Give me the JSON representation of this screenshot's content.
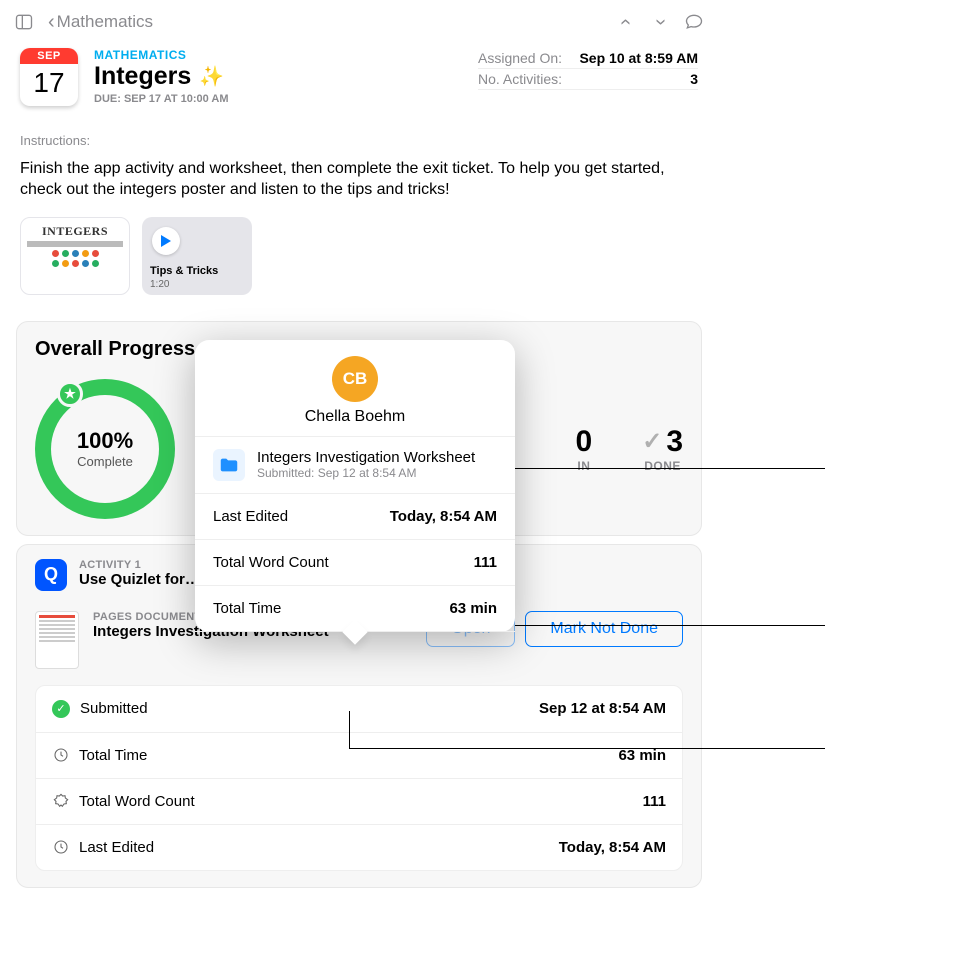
{
  "nav": {
    "back_label": "Mathematics"
  },
  "header": {
    "subject": "MATHEMATICS",
    "title": "Integers",
    "sparkle": "✨",
    "due": "DUE: SEP 17 AT 10:00 AM",
    "cal_month": "SEP",
    "cal_day": "17",
    "assigned_on_label": "Assigned On:",
    "assigned_on_value": "Sep 10 at 8:59 AM",
    "activities_label": "No. Activities:",
    "activities_value": "3"
  },
  "instructions": {
    "label": "Instructions:",
    "body": "Finish the app activity and worksheet, then complete the exit ticket. To help you get started, check out the integers poster and listen to the tips and tricks!"
  },
  "attachments": {
    "poster_title": "INTEGERS",
    "video_name": "Tips & Tricks",
    "video_duration": "1:20"
  },
  "progress": {
    "heading": "Overall Progress",
    "percent": "100%",
    "complete_label": "Complete",
    "stat_mid_value": "0",
    "stat_mid_label": "IN",
    "stat_done_value": "3",
    "stat_done_label": "DONE"
  },
  "activity1": {
    "kicker": "ACTIVITY 1",
    "name": "Use Quizlet for…",
    "doc_kicker": "PAGES DOCUMENT",
    "doc_title": "Integers Investigation Worksheet",
    "open_label": "Open",
    "mark_label": "Mark Not Done",
    "rows": {
      "submitted_label": "Submitted",
      "submitted_value": "Sep 12 at 8:54 AM",
      "time_label": "Total Time",
      "time_value": "63 min",
      "words_label": "Total Word Count",
      "words_value": "111",
      "edited_label": "Last Edited",
      "edited_value": "Today, 8:54 AM"
    }
  },
  "popover": {
    "initials": "CB",
    "student_name": "Chella Boehm",
    "file_title": "Integers Investigation Worksheet",
    "file_sub": "Submitted: Sep 12 at 8:54 AM",
    "row1_label": "Last Edited",
    "row1_value": "Today, 8:54 AM",
    "row2_label": "Total Word Count",
    "row2_value": "111",
    "row3_label": "Total Time",
    "row3_value": "63 min"
  }
}
